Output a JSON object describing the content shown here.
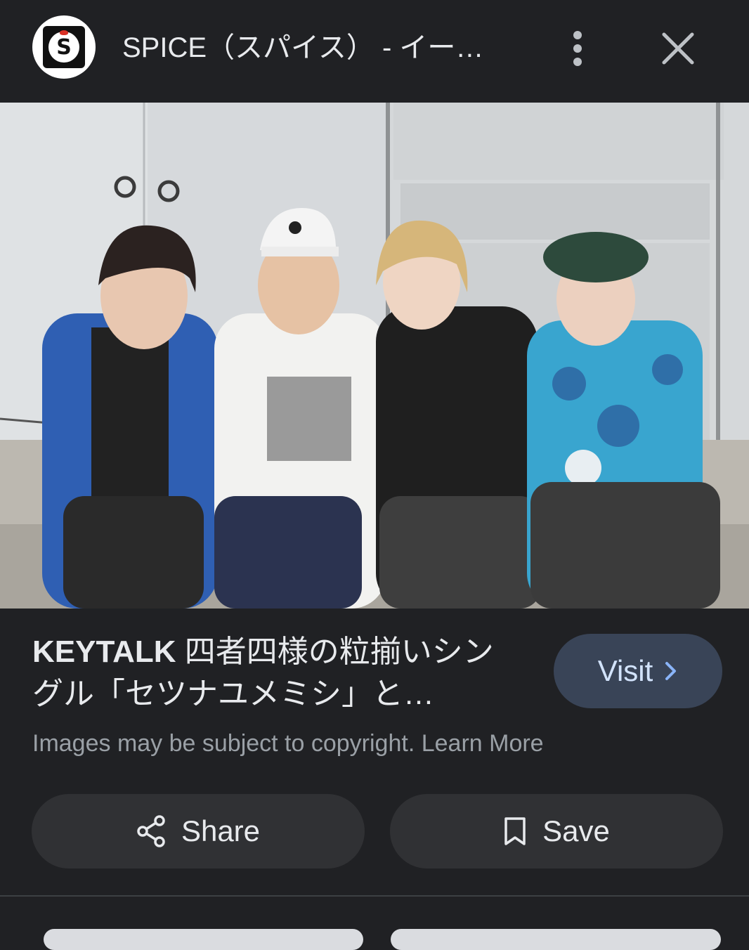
{
  "header": {
    "site_title": "SPICE（スパイス） - イー…",
    "logo_letter": "S",
    "more_icon": "more-vert-icon",
    "close_icon": "close-icon"
  },
  "image": {
    "lens_icon": "google-lens-icon",
    "description_colors": {
      "wall": "#d4d7d9",
      "ground": "#b9b5ad"
    }
  },
  "result": {
    "title_latin": "KEYTALK",
    "title_rest": " 四者四様の粒揃いシングル「セツナユメミシ」と…",
    "visit_label": "Visit",
    "copyright_text": "Images may be subject to copyright. Learn More"
  },
  "actions": {
    "share_label": "Share",
    "save_label": "Save"
  },
  "colors": {
    "background": "#202124",
    "visit_button": "#394457",
    "action_button": "#303134",
    "muted_text": "#9aa0a6"
  }
}
